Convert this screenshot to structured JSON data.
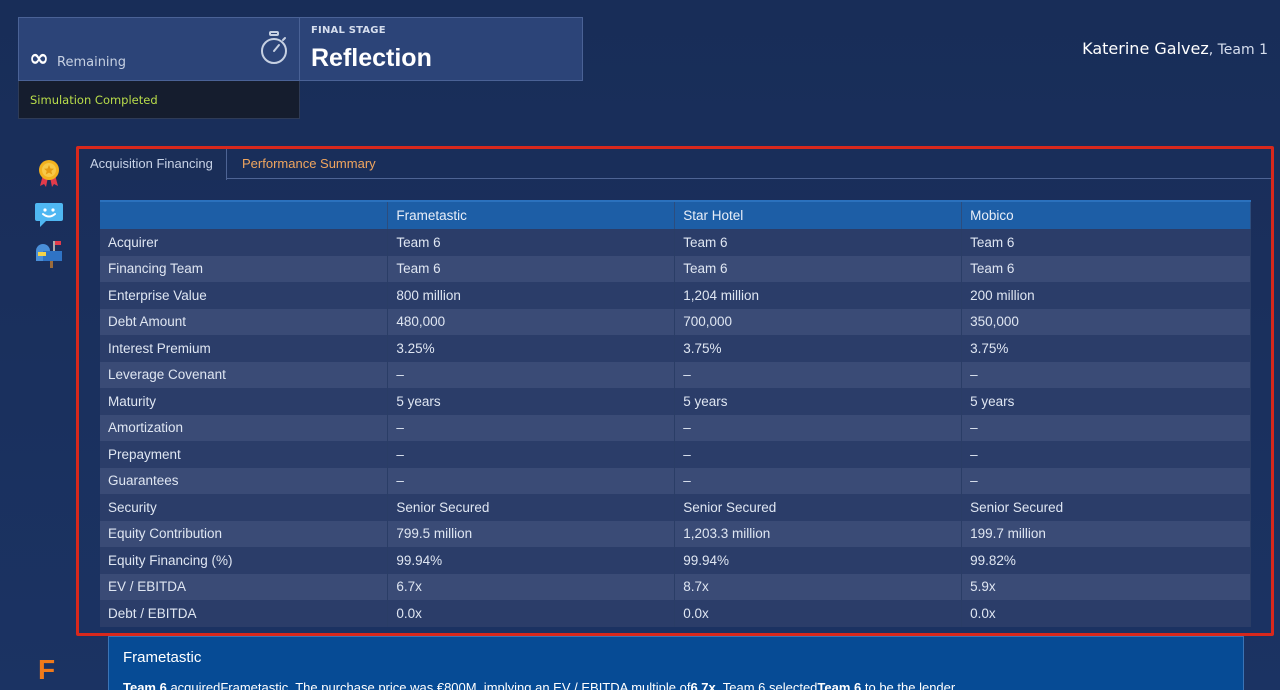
{
  "header": {
    "remaining_label": "Remaining",
    "infinity_symbol": "∞",
    "status": "Simulation Completed",
    "stage_label": "FINAL STAGE",
    "stage_title": "Reflection",
    "user_name": "Katerine Galvez",
    "user_team": ", Team 1"
  },
  "sidebar": {
    "icons": [
      "award-icon",
      "chat-icon",
      "mailbox-icon"
    ]
  },
  "tabs": [
    {
      "label": "Acquisition Financing",
      "active": true
    },
    {
      "label": "Performance Summary",
      "active": false
    }
  ],
  "table": {
    "columns": [
      "",
      "Frametastic",
      "Star Hotel",
      "Mobico"
    ],
    "rows": [
      [
        "Acquirer",
        "Team 6",
        "Team 6",
        "Team 6"
      ],
      [
        "Financing Team",
        "Team 6",
        "Team 6",
        "Team 6"
      ],
      [
        "Enterprise Value",
        "800 million",
        "1,204 million",
        "200 million"
      ],
      [
        "Debt Amount",
        "480,000",
        "700,000",
        "350,000"
      ],
      [
        "Interest Premium",
        "3.25%",
        "3.75%",
        "3.75%"
      ],
      [
        "Leverage Covenant",
        "–",
        "–",
        "–"
      ],
      [
        "Maturity",
        "5 years",
        "5 years",
        "5 years"
      ],
      [
        "Amortization",
        "–",
        "–",
        "–"
      ],
      [
        "Prepayment",
        "–",
        "–",
        "–"
      ],
      [
        "Guarantees",
        "–",
        "–",
        "–"
      ],
      [
        "Security",
        "Senior Secured",
        "Senior Secured",
        "Senior Secured"
      ],
      [
        "Equity Contribution",
        "799.5 million",
        "1,203.3 million",
        "199.7 million"
      ],
      [
        "Equity Financing (%)",
        "99.94%",
        "99.94%",
        "99.82%"
      ],
      [
        "EV / EBITDA",
        "6.7x",
        "8.7x",
        "5.9x"
      ],
      [
        "Debt / EBITDA",
        "0.0x",
        "0.0x",
        "0.0x"
      ]
    ]
  },
  "summary": {
    "title": "Frametastic",
    "team_a": "Team 6",
    "text_1": " acquiredFrametastic. The purchase price was €800M, implying an EV / EBITDA multiple of",
    "multiple": "6.7x",
    "text_2": ". Team 6 selected",
    "team_b": "Team 6",
    "text_3": " to be the lender."
  },
  "logo_letter": "F",
  "colors": {
    "background": "#1a2f5c",
    "highlight_frame": "#d8281c",
    "status_green": "#b9dd4a",
    "tab_inactive": "#f0a55e",
    "table_header": "#1d5ea6",
    "summary_panel": "#064b95",
    "logo_orange": "#f07a1a"
  }
}
